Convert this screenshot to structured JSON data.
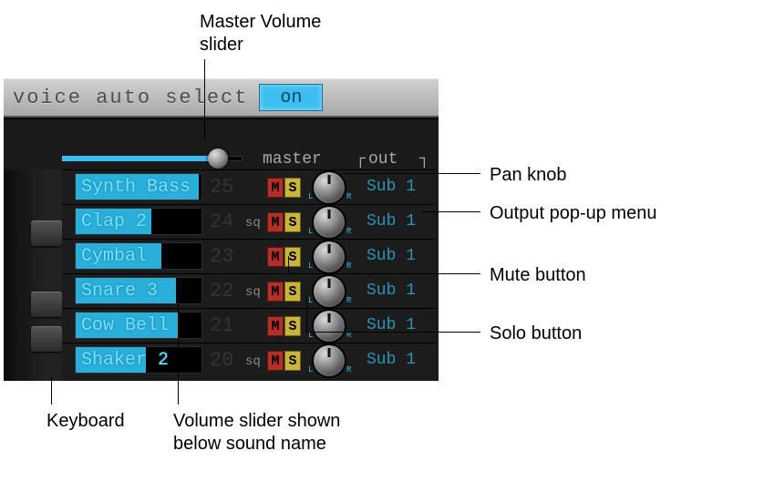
{
  "callouts": {
    "master_volume": "Master Volume\nslider",
    "pan_knob": "Pan knob",
    "output_menu": "Output pop-up menu",
    "mute": "Mute button",
    "solo": "Solo button",
    "keyboard": "Keyboard",
    "volume_slider": "Volume slider shown\nbelow sound name"
  },
  "header": {
    "voice_auto_select": "voice auto select",
    "toggle": "on"
  },
  "master": {
    "label": "master",
    "out": "out"
  },
  "ms": {
    "m": "M",
    "s": "S",
    "sq": "sq",
    "l": "L",
    "r": "R"
  },
  "voices": [
    {
      "name": "Synth Bass",
      "num": "25",
      "sq": false,
      "fill": 98,
      "out": "Sub 1"
    },
    {
      "name": "Clap 2",
      "num": "24",
      "sq": true,
      "fill": 60,
      "out": "Sub 1"
    },
    {
      "name": "Cymbal",
      "num": "23",
      "sq": false,
      "fill": 68,
      "out": "Sub 1"
    },
    {
      "name": "Snare 3",
      "num": "22",
      "sq": true,
      "fill": 80,
      "out": "Sub 1"
    },
    {
      "name": "Cow Bell",
      "num": "21",
      "sq": false,
      "fill": 82,
      "out": "Sub 1"
    },
    {
      "name": "Shaker 2",
      "num": "20",
      "sq": true,
      "fill": 56,
      "out": "Sub 1"
    }
  ]
}
